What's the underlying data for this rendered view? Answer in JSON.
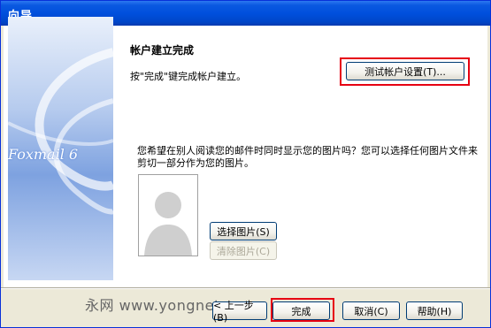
{
  "window": {
    "title": "向导"
  },
  "banner": {
    "brand_text": "Foxmail 6"
  },
  "page": {
    "heading": "帐户建立完成",
    "description": "按\"完成\"键完成帐户建立。",
    "test_button_label": "测试帐户设置(T)...",
    "question_text": "您希望在别人阅读您的邮件时同时显示您的图片吗？您可以选择任何图片文件来剪切一部分作为您的图片。",
    "choose_picture_label": "选择图片(S)",
    "clear_picture_label": "清除图片(C)"
  },
  "footer": {
    "watermark": "永网 www.yongnet.com",
    "back_label": "< 上一步(B)",
    "finish_label": "完成",
    "cancel_label": "取消(C)",
    "help_label": "帮助(H)"
  },
  "colors": {
    "title_bar": "#0050dd",
    "highlight": "#e60012",
    "dialog_face": "#ece9d8"
  }
}
